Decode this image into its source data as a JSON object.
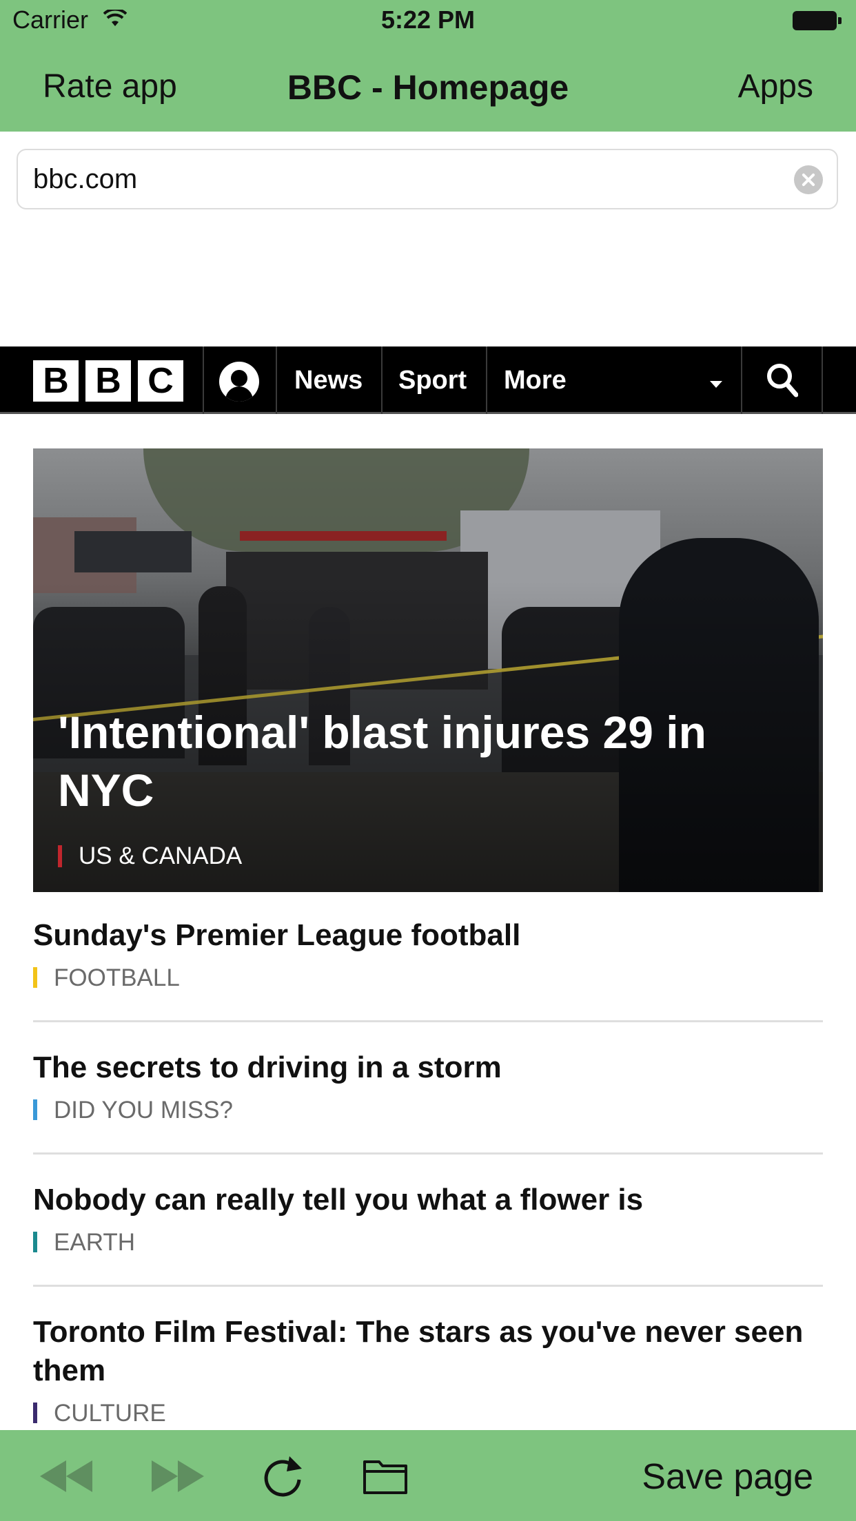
{
  "status_bar": {
    "carrier": "Carrier",
    "time": "5:22 PM"
  },
  "nav_bar": {
    "left_button": "Rate app",
    "title": "BBC - Homepage",
    "right_button": "Apps"
  },
  "url_bar": {
    "value": "bbc.com"
  },
  "bbc_header": {
    "logo_letters": [
      "B",
      "B",
      "C"
    ],
    "nav_items": [
      "News",
      "Sport",
      "More"
    ]
  },
  "hero": {
    "headline": "'Intentional' blast injures 29 in NYC",
    "tag": "US & CANADA"
  },
  "stories": [
    {
      "title": "Sunday's Premier League football",
      "tag": "FOOTBALL",
      "tag_color": "#f2c318"
    },
    {
      "title": "The secrets to driving in a storm",
      "tag": "DID YOU MISS?",
      "tag_color": "#3a99d8"
    },
    {
      "title": "Nobody can really tell you what a flower is",
      "tag": "EARTH",
      "tag_color": "#1b8a8f"
    },
    {
      "title": "Toronto Film Festival: The stars as you've never seen them",
      "tag": "CULTURE",
      "tag_color": "#3b2b6e"
    }
  ],
  "toolbar": {
    "icons": [
      "rewind-icon",
      "fast-forward-icon",
      "refresh-icon",
      "folder-icon"
    ],
    "save_label": "Save page"
  },
  "colors": {
    "app_green": "#7ec47f",
    "bbc_black": "#000000",
    "hero_tag_red": "#c0262d"
  }
}
